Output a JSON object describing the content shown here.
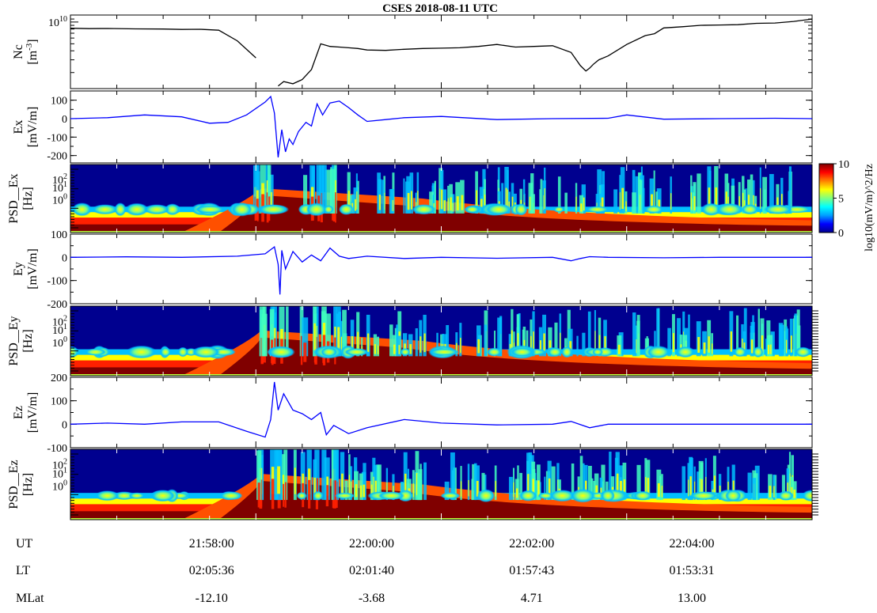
{
  "title": "CSES  2018-08-11 UTC",
  "chart_data": [
    {
      "id": "ne",
      "type": "line",
      "ylabel": "Nc",
      "yunit": "[m-3]",
      "yscale": "log",
      "yticks": [
        "10^10"
      ],
      "color": "#000000",
      "x": [
        0.0,
        0.1,
        0.2,
        0.35,
        0.5,
        0.6,
        0.7,
        0.8,
        0.9,
        1.0,
        1.07,
        1.12,
        1.15,
        1.2,
        1.25,
        1.3,
        1.35,
        1.4,
        1.45,
        1.5,
        1.55,
        1.6,
        1.7,
        1.8,
        1.9,
        2.0,
        2.1,
        2.2,
        2.3,
        2.4,
        2.5,
        2.6,
        2.7,
        2.75,
        2.78,
        2.8,
        2.82,
        2.85,
        2.9,
        3.0,
        3.1,
        3.15,
        3.2,
        3.3,
        3.4,
        3.5,
        3.6,
        3.7,
        3.8,
        3.9,
        4.0
      ],
      "y": [
        8.2,
        8.1,
        8.15,
        8.05,
        8.0,
        7.9,
        7.95,
        7.7,
        5.5,
        3.2,
        null,
        1.3,
        1.5,
        1.4,
        1.6,
        2.2,
        5.0,
        4.6,
        4.5,
        4.4,
        4.3,
        4.1,
        4.05,
        4.2,
        4.3,
        4.35,
        4.4,
        4.6,
        4.9,
        4.5,
        4.6,
        4.7,
        3.8,
        2.5,
        2.1,
        2.3,
        2.6,
        3.0,
        3.4,
        4.9,
        6.5,
        6.9,
        8.3,
        8.6,
        9.0,
        9.1,
        9.2,
        9.6,
        9.7,
        10.2,
        11.0
      ]
    },
    {
      "id": "ex",
      "type": "line",
      "ylabel": "Ex",
      "yunit": "[mV/m]",
      "ylim": [
        -240,
        150
      ],
      "yticks": [
        "100",
        "0",
        "-100",
        "-200"
      ],
      "color": "#0000ff",
      "x": [
        0.0,
        0.2,
        0.4,
        0.6,
        0.75,
        0.85,
        0.95,
        1.05,
        1.08,
        1.1,
        1.12,
        1.14,
        1.16,
        1.18,
        1.2,
        1.23,
        1.27,
        1.3,
        1.33,
        1.36,
        1.4,
        1.45,
        1.5,
        1.55,
        1.6,
        1.7,
        1.8,
        2.0,
        2.3,
        2.6,
        2.9,
        3.0,
        3.2,
        3.5,
        3.8,
        4.0
      ],
      "y": [
        0,
        5,
        20,
        10,
        -25,
        -20,
        20,
        90,
        120,
        30,
        -210,
        -60,
        -180,
        -110,
        -140,
        -70,
        -20,
        -40,
        80,
        20,
        85,
        95,
        60,
        20,
        -15,
        -5,
        5,
        12,
        -5,
        0,
        2,
        20,
        -3,
        0,
        2,
        0
      ]
    },
    {
      "id": "psd_ex",
      "type": "heatmap",
      "ylabel": "PSD__Ex",
      "yunit": "[Hz]",
      "yticks": [
        "10^2",
        "10^1",
        "10^0"
      ]
    },
    {
      "id": "ey",
      "type": "line",
      "ylabel": "Ey",
      "yunit": "[mV/m]",
      "ylim": [
        -200,
        100
      ],
      "yticks": [
        "100",
        "0",
        "-100",
        "-200"
      ],
      "color": "#0000ff",
      "x": [
        0.0,
        0.3,
        0.6,
        0.9,
        1.05,
        1.1,
        1.12,
        1.13,
        1.14,
        1.16,
        1.2,
        1.25,
        1.3,
        1.35,
        1.4,
        1.45,
        1.5,
        1.6,
        1.8,
        2.0,
        2.3,
        2.6,
        2.7,
        2.75,
        2.8,
        2.9,
        3.2,
        3.5,
        4.0
      ],
      "y": [
        0,
        2,
        0,
        5,
        15,
        45,
        -30,
        -160,
        30,
        -50,
        25,
        -20,
        10,
        -15,
        40,
        5,
        -5,
        5,
        -5,
        0,
        -4,
        0,
        -15,
        -5,
        3,
        0,
        -2,
        0,
        0
      ]
    },
    {
      "id": "psd_ey",
      "type": "heatmap",
      "ylabel": "PSD__Ey",
      "yunit": "[Hz]",
      "yticks": [
        "10^2",
        "10^1",
        "10^0"
      ]
    },
    {
      "id": "ez",
      "type": "line",
      "ylabel": "Ez",
      "yunit": "[mV/m]",
      "ylim": [
        -100,
        200
      ],
      "yticks": [
        "200",
        "100",
        "0",
        "-100"
      ],
      "color": "#0000ff",
      "x": [
        0.0,
        0.2,
        0.4,
        0.6,
        0.8,
        0.95,
        1.05,
        1.08,
        1.1,
        1.12,
        1.15,
        1.2,
        1.25,
        1.3,
        1.35,
        1.38,
        1.42,
        1.5,
        1.6,
        1.8,
        2.0,
        2.3,
        2.6,
        2.7,
        2.8,
        2.9,
        3.2,
        3.5,
        4.0
      ],
      "y": [
        0,
        5,
        0,
        10,
        10,
        -30,
        -55,
        20,
        180,
        60,
        130,
        60,
        45,
        20,
        50,
        -45,
        -5,
        -40,
        -15,
        20,
        5,
        -3,
        0,
        12,
        -15,
        0,
        0,
        0,
        0
      ]
    },
    {
      "id": "psd_ez",
      "type": "heatmap",
      "ylabel": "PSD__Ez",
      "yunit": "[Hz]",
      "yticks": [
        "10^2",
        "10^1",
        "10^0"
      ]
    }
  ],
  "colorbar": {
    "label": "log10(mV/m)^2/Hz",
    "ticks": [
      "10",
      "5",
      "0"
    ],
    "stops": [
      "#00008f",
      "#0000ff",
      "#00a0ff",
      "#00ffff",
      "#80ff80",
      "#ffff00",
      "#ff8000",
      "#ff0000",
      "#800000"
    ]
  },
  "bottom_axis": {
    "rows": [
      {
        "label": "UT",
        "values": [
          "21:58:00",
          "22:00:00",
          "22:02:00",
          "22:04:00"
        ]
      },
      {
        "label": "LT",
        "values": [
          "02:05:36",
          "02:01:40",
          "01:57:43",
          "01:53:31"
        ]
      },
      {
        "label": "MLat",
        "values": [
          "-12.10",
          "-3.68",
          "4.71",
          "13.00"
        ]
      }
    ]
  }
}
